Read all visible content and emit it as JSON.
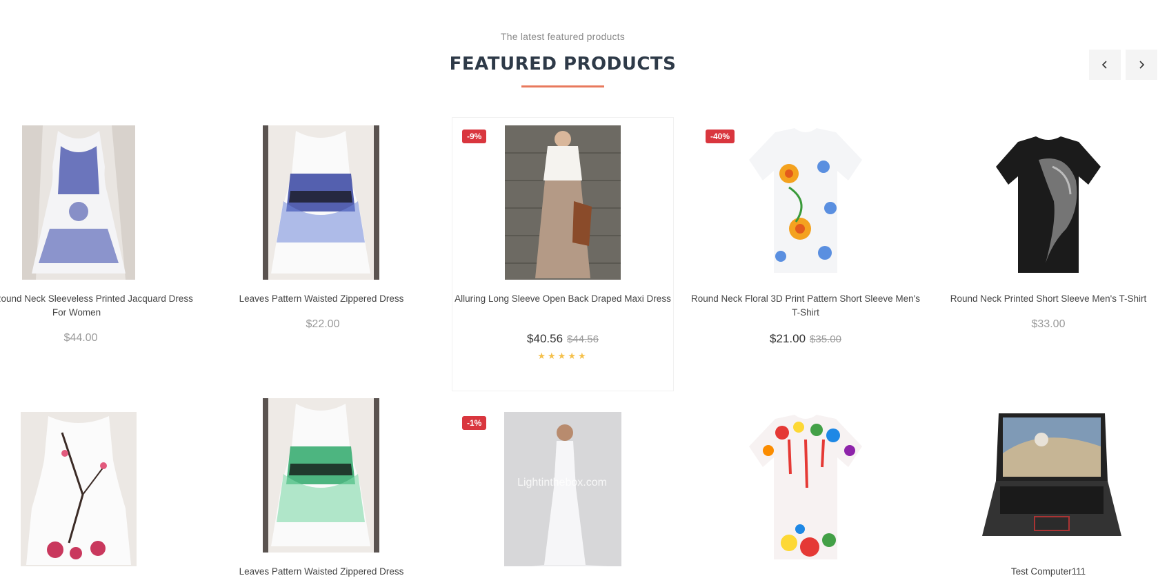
{
  "section": {
    "subtitle": "The latest featured products",
    "title": "FEATURED PRODUCTS"
  },
  "carousel": {
    "prev_icon": "chevron-left-icon",
    "next_icon": "chevron-right-icon"
  },
  "products": [
    {
      "name": "Elegant Round Neck Sleeveless Printed Jacquard Dress For Women",
      "price": "$44.00"
    },
    {
      "name": "Leaves Pattern Waisted Zippered Dress",
      "price": "$22.00"
    },
    {
      "name": "Alluring Long Sleeve Open Back Draped Maxi Dress",
      "price": "$40.56",
      "old_price": "$44.56",
      "badge": "-9%",
      "rating": "★★★★★"
    },
    {
      "name": "Round Neck Floral 3D Print Pattern Short Sleeve Men's T-Shirt",
      "price": "$21.00",
      "old_price": "$35.00",
      "badge": "-40%"
    },
    {
      "name": "Round Neck Printed Short Sleeve Men's T-Shirt",
      "price": "$33.00"
    },
    {
      "name": "",
      "price": ""
    },
    {
      "name": "Leaves Pattern Waisted Zippered Dress",
      "price": ""
    },
    {
      "name": "",
      "price": "",
      "badge": "-1%",
      "watermark": "Lightinthebox.com"
    },
    {
      "name": "",
      "price": ""
    },
    {
      "name": "Test Computer111",
      "price": ""
    }
  ],
  "colors": {
    "accent": "#e8795d",
    "badge": "#d9363e",
    "title": "#2e3a48",
    "star": "#f5c04a"
  }
}
